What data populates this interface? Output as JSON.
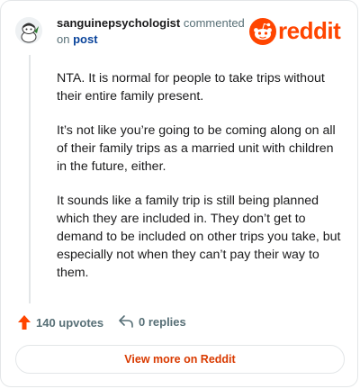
{
  "header": {
    "username": "sanguinepsychologist",
    "action_text": " commented",
    "on_text": "on ",
    "post_link": "post",
    "brand": "reddit"
  },
  "comment": {
    "paragraphs": [
      "NTA. It is normal for people to take trips without their entire family present.",
      "It’s not like you’re going to be coming along on all of their family trips as a married unit with children in the future, either.",
      "It sounds like a family trip is still being planned which they are included in. They don’t get to demand to be included on other trips you take, but especially not when they can’t pay their way to them."
    ]
  },
  "actions": {
    "upvotes": "140 upvotes",
    "replies": "0 replies"
  },
  "footer": {
    "view_more": "View more on Reddit"
  },
  "colors": {
    "brand": "#ff4500",
    "view_more_text": "#d93a00",
    "link": "#0a449b"
  },
  "icons": [
    "user-avatar-icon",
    "reddit-snoo-icon",
    "upvote-arrow-icon",
    "reply-arrow-icon"
  ]
}
